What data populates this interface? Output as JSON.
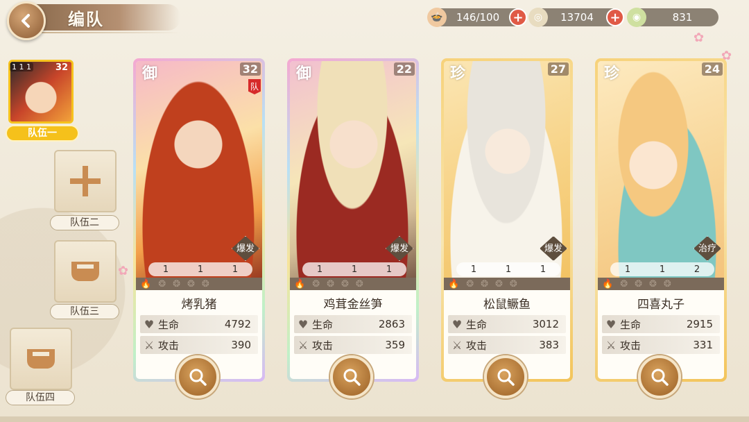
{
  "header": {
    "title": "编队",
    "resources": [
      {
        "name": "stamina",
        "icon": "bowl-icon",
        "value": "146/100",
        "has_plus": true
      },
      {
        "name": "coin",
        "icon": "coin-icon",
        "value": "13704",
        "has_plus": true
      },
      {
        "name": "gem",
        "icon": "gem-icon",
        "value": "831",
        "has_plus": false
      }
    ],
    "plus": "+"
  },
  "teams": [
    {
      "label": "队伍一",
      "active": true,
      "mini_stats": "1 1 1",
      "level": "32"
    },
    {
      "label": "队伍二",
      "active": false,
      "icon": "plus-icon"
    },
    {
      "label": "队伍三",
      "active": false,
      "icon": "cushion-icon"
    },
    {
      "label": "队伍四",
      "active": false,
      "icon": "cushion-icon"
    }
  ],
  "cards": [
    {
      "name": "烤乳猪",
      "rarity": "御",
      "rarity_color": "blue",
      "level": "32",
      "team_flag": "队",
      "role": "爆发",
      "skills": [
        "1",
        "1",
        "1"
      ],
      "hp_label": "生命",
      "hp": "4792",
      "atk_label": "攻击",
      "atk": "390",
      "frame": "rainbow"
    },
    {
      "name": "鸡茸金丝笋",
      "rarity": "御",
      "rarity_color": "blue",
      "level": "22",
      "team_flag": "",
      "role": "爆发",
      "skills": [
        "1",
        "1",
        "1"
      ],
      "hp_label": "生命",
      "hp": "2863",
      "atk_label": "攻击",
      "atk": "359",
      "frame": "rainbow"
    },
    {
      "name": "松鼠鳜鱼",
      "rarity": "珍",
      "rarity_color": "orange",
      "level": "27",
      "team_flag": "",
      "role": "爆发",
      "skills": [
        "1",
        "1",
        "1"
      ],
      "hp_label": "生命",
      "hp": "3012",
      "atk_label": "攻击",
      "atk": "383",
      "frame": "gold"
    },
    {
      "name": "四喜丸子",
      "rarity": "珍",
      "rarity_color": "orange",
      "level": "24",
      "team_flag": "",
      "role": "治疗",
      "skills": [
        "1",
        "1",
        "2"
      ],
      "hp_label": "生命",
      "hp": "2915",
      "atk_label": "攻击",
      "atk": "331",
      "frame": "gold"
    }
  ],
  "colors": {
    "accent_gold": "#f5c11b",
    "plus_red": "#e05a46",
    "rare_blue": "#8ea8e8",
    "rare_orange": "#f1a03a"
  }
}
